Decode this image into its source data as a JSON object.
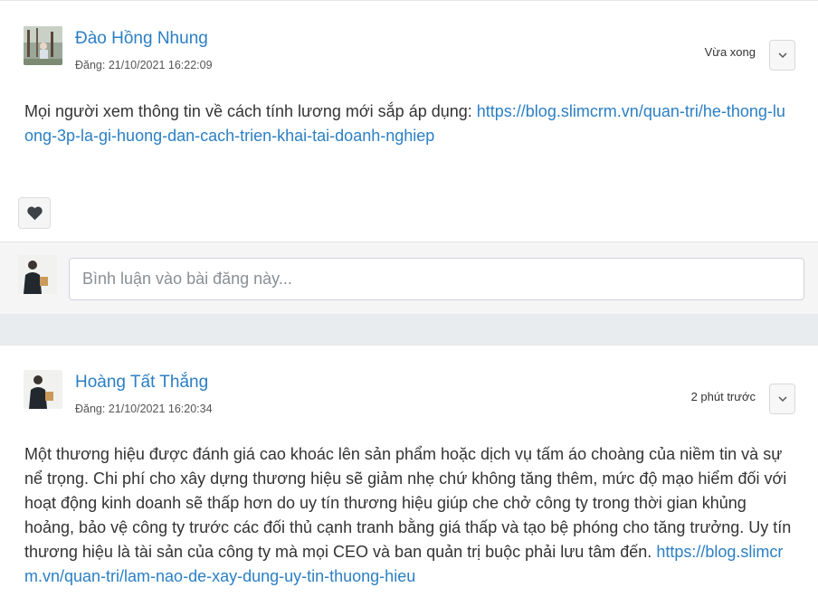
{
  "posts": [
    {
      "author": "Đào Hồng Nhung",
      "posted_at": "Đăng: 21/10/2021 16:22:09",
      "time_ago": "Vừa xong",
      "content_text": "Mọi người xem thông tin về cách tính lương mới sắp áp dụng: ",
      "content_link": "https://blog.slimcrm.vn/quan-tri/he-thong-luong-3p-la-gi-huong-dan-cach-trien-khai-tai-doanh-nghiep"
    },
    {
      "author": "Hoàng Tất Thắng",
      "posted_at": "Đăng: 21/10/2021 16:20:34",
      "time_ago": "2 phút trước",
      "content_text": "Một thương hiệu được đánh giá cao khoác lên sản phẩm hoặc dịch vụ tấm áo choàng của niềm tin và sự nể trọng. Chi phí cho xây dựng thương hiệu sẽ giảm nhẹ chứ không tăng thêm, mức độ mạo hiểm đối với hoạt động kinh doanh sẽ thấp hơn do uy tín thương hiệu giúp che chở công ty trong thời gian khủng hoảng, bảo vệ công ty trước các đối thủ cạnh tranh bằng giá thấp và tạo bệ phóng cho tăng trưởng. Uy tín thương hiệu là tài sản của công ty mà mọi CEO và ban quản trị buộc phải lưu tâm đến.",
      "content_link": "https://blog.slimcrm.vn/quan-tri/lam-nao-de-xay-dung-uy-tin-thuong-hieu"
    }
  ],
  "comment": {
    "placeholder": "Bình luận vào bài đăng này..."
  },
  "icons": {
    "like": "heart-icon",
    "menu": "chevron-down-icon"
  },
  "colors": {
    "link": "#2b7fc4",
    "page_background": "#e9ecef"
  }
}
